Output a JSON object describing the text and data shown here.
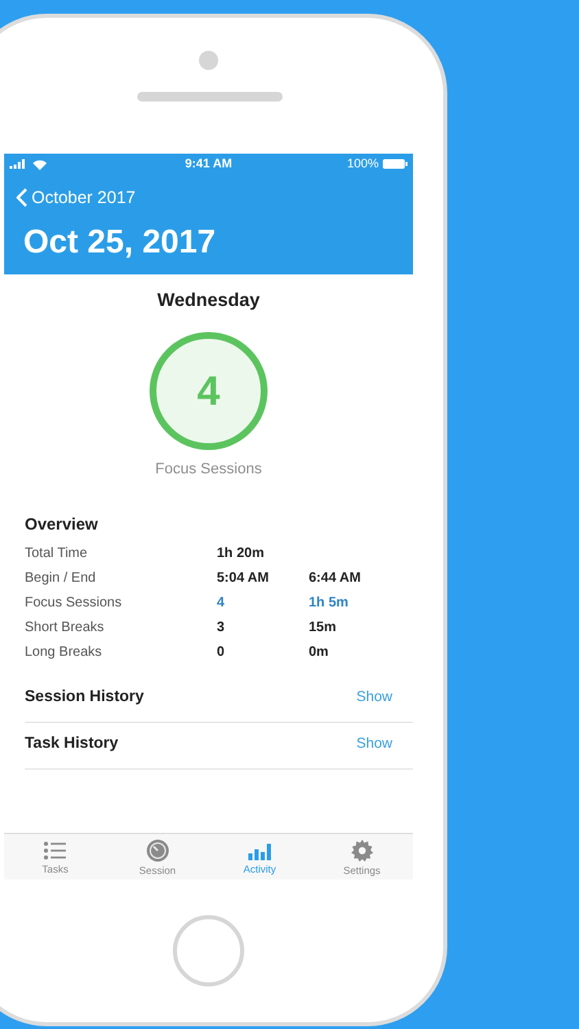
{
  "status_bar": {
    "time": "9:41 AM",
    "battery": "100%"
  },
  "nav": {
    "back": "October 2017",
    "title": "Oct 25, 2017"
  },
  "day": "Wednesday",
  "summary": {
    "count": "4",
    "label": "Focus Sessions"
  },
  "overview": {
    "title": "Overview",
    "rows": [
      {
        "label": "Total Time",
        "value_1": "1h 20m",
        "accent": false
      },
      {
        "label": "Begin / End",
        "value_1": "5:04 AM",
        "value_2": "6:44 AM",
        "accent": false
      },
      {
        "label": "Focus Sessions",
        "value_1": "4",
        "value_2": "1h 5m",
        "accent": true
      },
      {
        "label": "Short Breaks",
        "value_1": "3",
        "value_2": "15m",
        "accent": false
      },
      {
        "label": "Long Breaks",
        "value_1": "0",
        "value_2": "0m",
        "accent": false
      }
    ]
  },
  "sections": [
    {
      "title": "Session History",
      "action": "Show"
    },
    {
      "title": "Task History",
      "action": "Show"
    }
  ],
  "tab_bar": [
    {
      "kind": "list",
      "label": "Tasks",
      "selected": false
    },
    {
      "kind": "dial",
      "label": "Session",
      "selected": false
    },
    {
      "kind": "chart",
      "label": "Activity",
      "selected": true
    },
    {
      "kind": "gear",
      "label": "Settings",
      "selected": false
    }
  ]
}
